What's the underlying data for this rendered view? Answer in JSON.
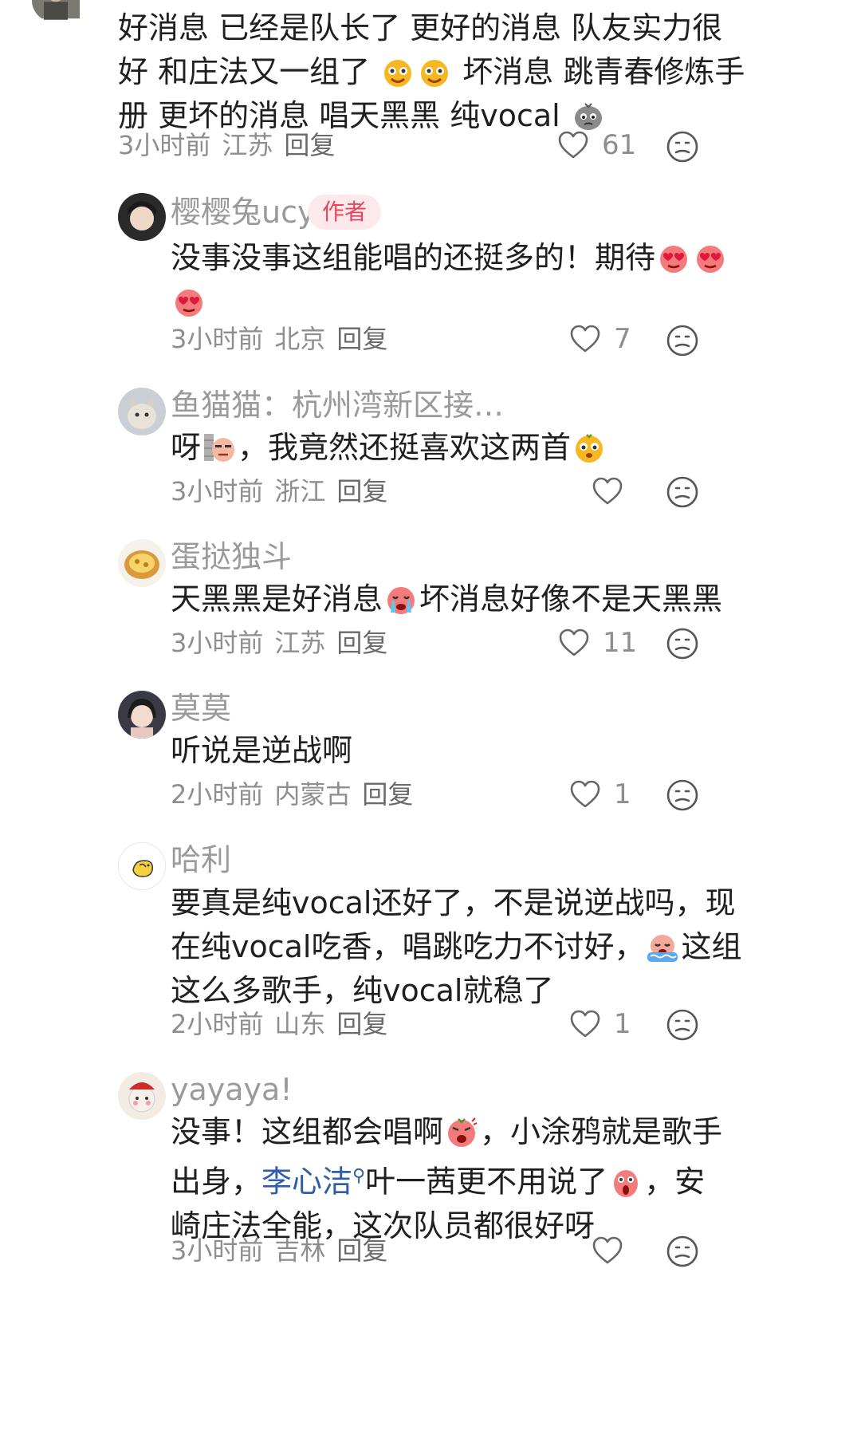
{
  "comments": [
    {
      "text_lines": [
        "好消息 已经是队长了 更好的消息 队友实力很",
        "好 和庄法又一组了",
        "坏消息 跳青春修炼手",
        "册 更坏的消息 唱天黑黑 纯vocal"
      ],
      "time": "3小时前",
      "location": "江苏",
      "reply": "回复",
      "likes": "61",
      "icons": [
        "cry-laugh-emoji-icon",
        "cry-laugh-emoji-icon",
        "sad-rock-emoji-icon"
      ]
    },
    {
      "username": "樱樱兔ucy",
      "badge": "作者",
      "text_lines": [
        "没事没事这组能唱的还挺多的！期待"
      ],
      "time": "3小时前",
      "location": "北京",
      "reply": "回复",
      "likes": "7"
    },
    {
      "username": "鱼猫猫：杭州湾新区接…",
      "text_a": "呀",
      "text_b": "，我竟然还挺喜欢这两首",
      "time": "3小时前",
      "location": "浙江",
      "reply": "回复",
      "likes": ""
    },
    {
      "username": "蛋挞独斗",
      "text_a": "天黑黑是好消息",
      "text_b": "坏消息好像不是天黑黑",
      "time": "3小时前",
      "location": "江苏",
      "reply": "回复",
      "likes": "11"
    },
    {
      "username": "莫莫",
      "text": "听说是逆战啊",
      "time": "2小时前",
      "location": "内蒙古",
      "reply": "回复",
      "likes": "1"
    },
    {
      "username": "哈利",
      "text_lines": [
        "要真是纯vocal还好了，不是说逆战吗，现",
        "在纯vocal吃香，唱跳吃力不讨好，",
        "这组",
        "这么多歌手，纯vocal就稳了"
      ],
      "time": "2小时前",
      "location": "山东",
      "reply": "回复",
      "likes": "1"
    },
    {
      "username": "yayaya!",
      "line1_a": "没事！这组都会唱啊",
      "line1_b": "，小涂鸦就是歌手",
      "line2_a": "出身，",
      "line2_link": "李心洁",
      "line2_b": "叶一茜更不用说了",
      "line2_c": "，安",
      "line3": "崎庄法全能，这次队员都很好呀",
      "time": "3小时前",
      "location": "吉林",
      "reply": "回复"
    }
  ],
  "colors": {
    "username": "#9a9a9a",
    "meta": "#8e8e8e",
    "author_badge_text": "#e6455a",
    "author_badge_bg": "#fde8eb",
    "link": "#2f5da8"
  }
}
